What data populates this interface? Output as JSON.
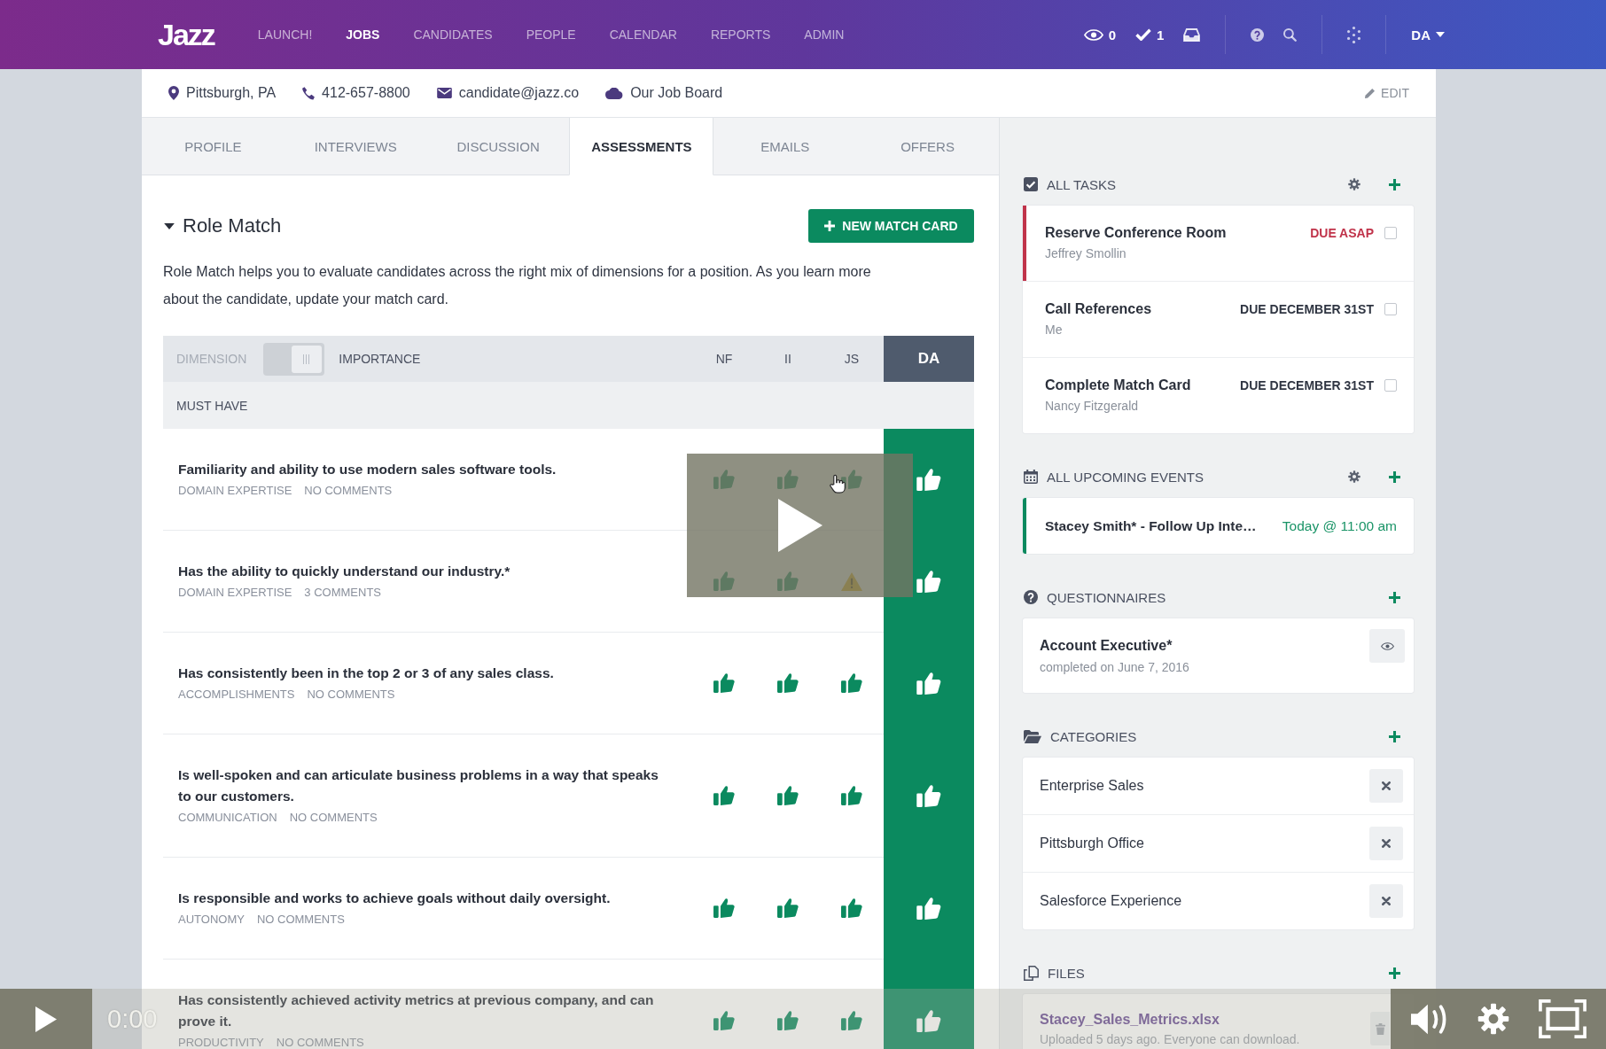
{
  "nav": {
    "logo": "Jazz",
    "items": [
      {
        "label": "LAUNCH!",
        "selected": false
      },
      {
        "label": "JOBS",
        "selected": true
      },
      {
        "label": "CANDIDATES",
        "selected": false
      },
      {
        "label": "PEOPLE",
        "selected": false
      },
      {
        "label": "CALENDAR",
        "selected": false
      },
      {
        "label": "REPORTS",
        "selected": false
      },
      {
        "label": "ADMIN",
        "selected": false
      }
    ],
    "counters": [
      {
        "kind": "watching",
        "value": "0"
      },
      {
        "kind": "tasks",
        "value": "1"
      }
    ],
    "user": "DA"
  },
  "contact": {
    "items": [
      {
        "kind": "location",
        "text": "Pittsburgh, PA"
      },
      {
        "kind": "phone",
        "text": "412-657-8800"
      },
      {
        "kind": "email",
        "text": "candidate@jazz.co"
      },
      {
        "kind": "job_board",
        "text": "Our Job Board"
      }
    ],
    "edit": "EDIT"
  },
  "tabs": [
    {
      "label": "PROFILE",
      "selected": false
    },
    {
      "label": "INTERVIEWS",
      "selected": false
    },
    {
      "label": "DISCUSSION",
      "selected": false
    },
    {
      "label": "ASSESSMENTS",
      "selected": true
    },
    {
      "label": "EMAILS",
      "selected": false
    },
    {
      "label": "OFFERS",
      "selected": false
    }
  ],
  "role_match": {
    "title": "Role Match",
    "expanded": true,
    "button": "NEW MATCH CARD",
    "description": "Role Match helps you to evaluate candidates across the right mix of dimensions for a position. As you learn more about the candidate, update your match card.",
    "table": {
      "toggle": {
        "left": "DIMENSION",
        "right": "IMPORTANCE",
        "on": true
      },
      "raters": [
        {
          "label": "NF",
          "selected": false
        },
        {
          "label": "II",
          "selected": false
        },
        {
          "label": "JS",
          "selected": false
        },
        {
          "label": "DA",
          "selected": true
        }
      ],
      "group": "MUST HAVE",
      "rows": [
        {
          "text": "Familiarity and ability to use modern sales software tools.",
          "dimension": "DOMAIN EXPERTISE",
          "comments": "NO COMMENTS",
          "ratings": [
            {
              "kind": "up"
            },
            {
              "kind": "up"
            },
            {
              "kind": "up"
            },
            {
              "kind": "up"
            }
          ]
        },
        {
          "text": "Has the ability to quickly understand our industry.*",
          "dimension": "DOMAIN EXPERTISE",
          "comments": "3 COMMENTS",
          "ratings": [
            {
              "kind": "up"
            },
            {
              "kind": "up"
            },
            {
              "kind": "warning"
            },
            {
              "kind": "up"
            }
          ]
        },
        {
          "text": "Has consistently been in the top 2 or 3 of any sales class.",
          "dimension": "ACCOMPLISHMENTS",
          "comments": "NO COMMENTS",
          "ratings": [
            {
              "kind": "up"
            },
            {
              "kind": "up"
            },
            {
              "kind": "up"
            },
            {
              "kind": "up"
            }
          ]
        },
        {
          "text": "Is well-spoken and can articulate business problems in a way that speaks to our customers.",
          "dimension": "COMMUNICATION",
          "comments": "NO COMMENTS",
          "ratings": [
            {
              "kind": "up"
            },
            {
              "kind": "up"
            },
            {
              "kind": "up"
            },
            {
              "kind": "up"
            }
          ]
        },
        {
          "text": "Is responsible and works to achieve goals without daily oversight.",
          "dimension": "AUTONOMY",
          "comments": "NO COMMENTS",
          "ratings": [
            {
              "kind": "up"
            },
            {
              "kind": "up"
            },
            {
              "kind": "up"
            },
            {
              "kind": "up"
            }
          ]
        },
        {
          "text": "Has consistently achieved activity metrics at previous company, and can prove it.",
          "dimension": "PRODUCTIVITY",
          "comments": "NO COMMENTS",
          "ratings": [
            {
              "kind": "up"
            },
            {
              "kind": "up"
            },
            {
              "kind": "up"
            },
            {
              "kind": "up"
            }
          ]
        }
      ]
    }
  },
  "sidebar": {
    "tasks": {
      "title": "ALL TASKS",
      "items": [
        {
          "title": "Reserve Conference Room",
          "assignee": "Jeffrey Smollin",
          "due": "DUE ASAP",
          "urgent": true,
          "checked": false
        },
        {
          "title": "Call References",
          "assignee": "Me",
          "due": "DUE DECEMBER 31ST",
          "urgent": false,
          "checked": false
        },
        {
          "title": "Complete Match Card",
          "assignee": "Nancy Fitzgerald",
          "due": "DUE DECEMBER 31ST",
          "urgent": false,
          "checked": false
        }
      ]
    },
    "events": {
      "title": "ALL UPCOMING EVENTS",
      "items": [
        {
          "title": "Stacey Smith* - Follow Up Inte…",
          "time": "Today @ 11:00 am"
        }
      ]
    },
    "questionnaires": {
      "title": "QUESTIONNAIRES",
      "items": [
        {
          "title": "Account Executive*",
          "status": "completed on June 7, 2016"
        }
      ]
    },
    "categories": {
      "title": "CATEGORIES",
      "items": [
        {
          "name": "Enterprise Sales"
        },
        {
          "name": "Pittsburgh Office"
        },
        {
          "name": "Salesforce Experience"
        }
      ]
    },
    "files": {
      "title": "FILES",
      "items": [
        {
          "name": "Stacey_Sales_Metrics.xlsx",
          "note": "Uploaded 5 days ago. Everyone can download."
        }
      ]
    }
  },
  "video": {
    "time": "0:00"
  }
}
